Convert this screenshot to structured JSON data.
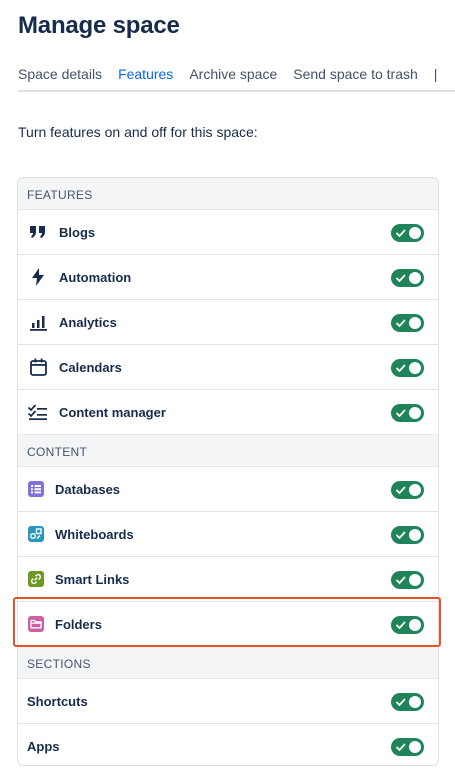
{
  "page_title": "Manage space",
  "tabs": [
    {
      "label": "Space details",
      "active": false
    },
    {
      "label": "Features",
      "active": true
    },
    {
      "label": "Archive space",
      "active": false
    },
    {
      "label": "Send space to trash",
      "active": false
    }
  ],
  "intro": "Turn features on and off for this space:",
  "sections": {
    "features": {
      "header": "FEATURES",
      "items": [
        {
          "label": "Blogs",
          "icon": "quote-icon",
          "enabled": true
        },
        {
          "label": "Automation",
          "icon": "lightning-icon",
          "enabled": true
        },
        {
          "label": "Analytics",
          "icon": "bar-chart-icon",
          "enabled": true
        },
        {
          "label": "Calendars",
          "icon": "calendar-icon",
          "enabled": true
        },
        {
          "label": "Content manager",
          "icon": "checklist-icon",
          "enabled": true
        }
      ]
    },
    "content": {
      "header": "CONTENT",
      "items": [
        {
          "label": "Databases",
          "icon": "database-icon",
          "enabled": true,
          "color": "#8270db"
        },
        {
          "label": "Whiteboards",
          "icon": "whiteboard-icon",
          "enabled": true,
          "color": "#2898bd"
        },
        {
          "label": "Smart Links",
          "icon": "link-icon",
          "enabled": true,
          "color": "#6a9a23"
        },
        {
          "label": "Folders",
          "icon": "folder-icon",
          "enabled": true,
          "color": "#d05ea3"
        }
      ]
    },
    "sections": {
      "header": "SECTIONS",
      "items": [
        {
          "label": "Shortcuts",
          "enabled": true
        },
        {
          "label": "Apps",
          "enabled": true
        }
      ]
    }
  },
  "colors": {
    "toggle_on": "#1f845a",
    "tab_active": "#0c66e4",
    "highlight": "#e5532d"
  }
}
